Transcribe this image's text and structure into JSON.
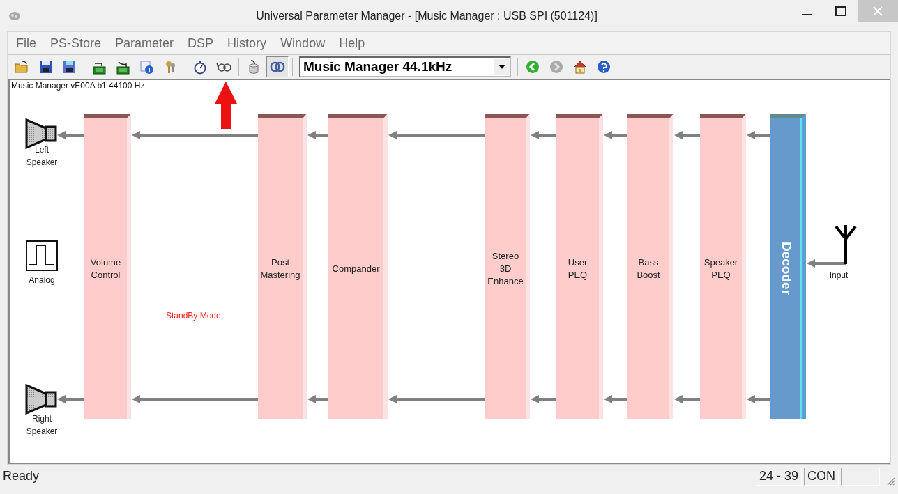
{
  "window": {
    "title": "Universal Parameter Manager - [Music Manager : USB SPI (501124)]"
  },
  "menu": [
    "File",
    "PS-Store",
    "Parameter",
    "DSP",
    "History",
    "Window",
    "Help"
  ],
  "toolbar": [
    {
      "kind": "open",
      "pressed": false
    },
    {
      "kind": "save",
      "pressed": false
    },
    {
      "kind": "save-as",
      "pressed": false
    },
    {
      "kind": "sep"
    },
    {
      "kind": "read-board",
      "pressed": false
    },
    {
      "kind": "write-board",
      "pressed": false
    },
    {
      "kind": "info",
      "pressed": false
    },
    {
      "kind": "keys",
      "pressed": false
    },
    {
      "kind": "sep"
    },
    {
      "kind": "stopwatch",
      "pressed": false
    },
    {
      "kind": "glasses",
      "pressed": false
    },
    {
      "kind": "sep"
    },
    {
      "kind": "cylinder",
      "pressed": false
    },
    {
      "kind": "link",
      "pressed": true
    }
  ],
  "preset": {
    "value": "Music Manager 44.1kHz"
  },
  "nav": [
    {
      "kind": "back",
      "disabled": false
    },
    {
      "kind": "forward",
      "disabled": true
    },
    {
      "kind": "home",
      "disabled": false
    },
    {
      "kind": "help",
      "disabled": false
    }
  ],
  "canvas": {
    "header": "Music Manager vE00A b1 44100 Hz",
    "outputs": [
      {
        "label": "Left\nSpeaker"
      },
      {
        "label": "Right\nSpeaker"
      }
    ],
    "source": {
      "label": "Analog"
    },
    "blocks": [
      {
        "kind": "stage",
        "label": "Volume\nControl"
      },
      {
        "kind": "stage",
        "label": "Post\nMastering"
      },
      {
        "kind": "stage",
        "label": "Compander"
      },
      {
        "kind": "stage",
        "label": "Stereo\n3D\nEnhance"
      },
      {
        "kind": "stage",
        "label": "User\nPEQ"
      },
      {
        "kind": "stage",
        "label": "Bass\nBoost"
      },
      {
        "kind": "stage",
        "label": "Speaker\nPEQ"
      },
      {
        "kind": "decoder",
        "label": "Decoder"
      }
    ],
    "status_text": "StandBy Mode",
    "input": {
      "label": "Input"
    }
  },
  "status_bar": {
    "message": "Ready",
    "panes": [
      "24 - 39",
      "CON"
    ]
  }
}
